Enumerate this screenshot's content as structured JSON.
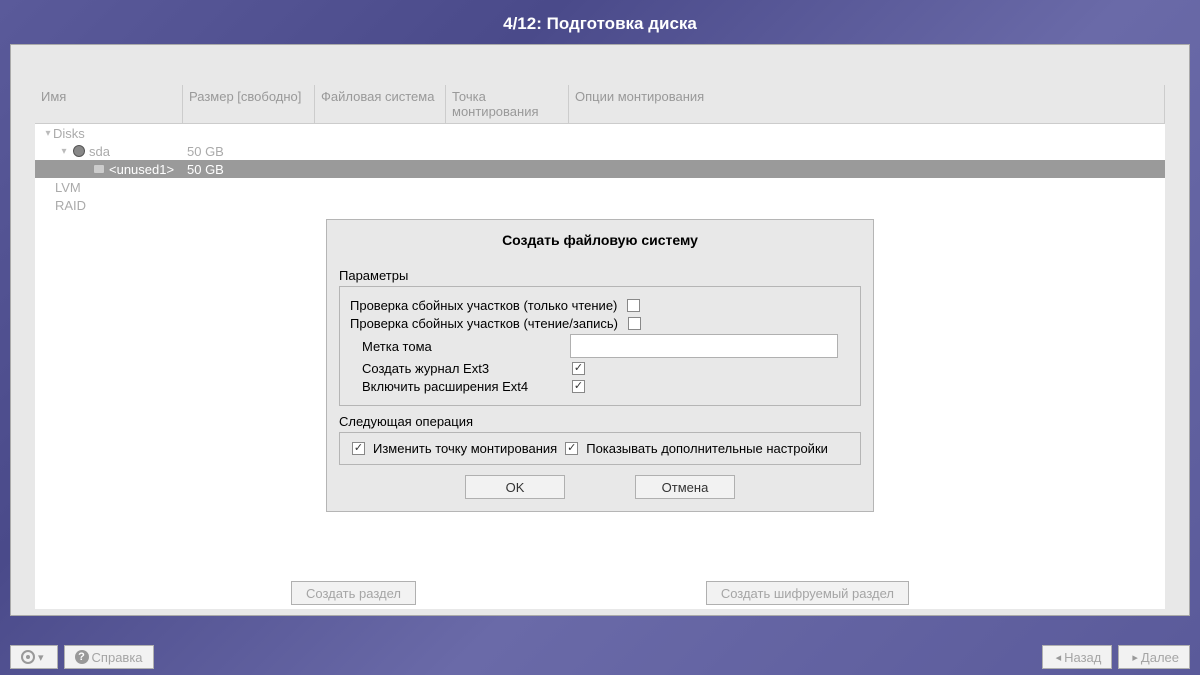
{
  "page": {
    "title": "4/12: Подготовка диска"
  },
  "columns": {
    "name": "Имя",
    "size": "Размер [свободно]",
    "fs": "Файловая система",
    "mount": "Точка монтирования",
    "opts": "Опции монтирования"
  },
  "tree": {
    "disks": "Disks",
    "sda": {
      "name": "sda",
      "size": "50 GB"
    },
    "unused": {
      "name": "<unused1>",
      "size": "50 GB"
    },
    "lvm": "LVM",
    "raid": "RAID"
  },
  "dialog": {
    "title": "Создать файловую систему",
    "params_label": "Параметры",
    "check_bad_ro": "Проверка сбойных участков (только чтение)",
    "check_bad_rw": "Проверка сбойных участков (чтение/запись)",
    "volume_label": "Метка тома",
    "volume_value": "",
    "ext3_journal": "Создать журнал Ext3",
    "ext4_ext": "Включить расширения Ext4",
    "next_op_label": "Следующая операция",
    "change_mount": "Изменить точку монтирования",
    "show_advanced": "Показывать дополнительные настройки",
    "ok": "OK",
    "cancel": "Отмена"
  },
  "bottom_buttons": {
    "create_partition": "Создать раздел",
    "create_encrypted": "Создать шифруемый раздел"
  },
  "footer": {
    "help": "Справка",
    "back": "Назад",
    "next": "Далее"
  }
}
